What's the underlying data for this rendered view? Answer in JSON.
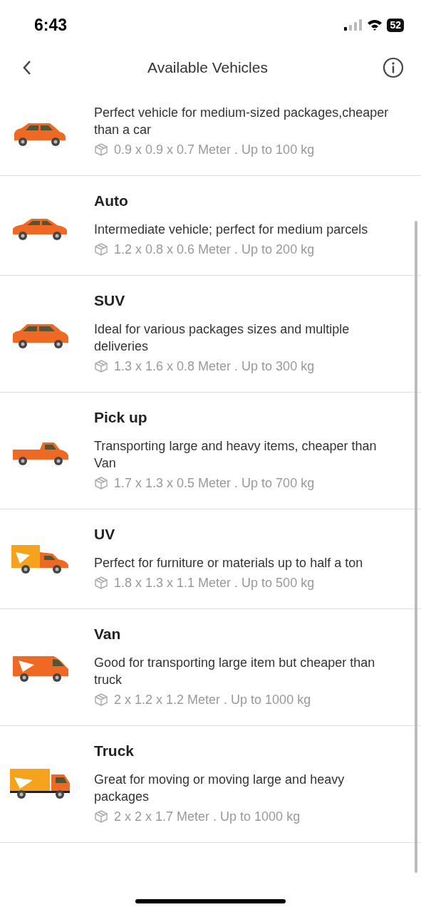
{
  "status_bar": {
    "time": "6:43",
    "battery": "52"
  },
  "header": {
    "title": "Available Vehicles"
  },
  "vehicles": [
    {
      "kind": "hatchback",
      "description": "Perfect vehicle for medium-sized packages,cheaper than a car",
      "spec": "0.9 x 0.9 x 0.7 Meter . Up to 100 kg"
    },
    {
      "kind": "sedan",
      "name": "Auto",
      "description": "Intermediate vehicle; perfect for medium parcels",
      "spec": "1.2 x 0.8 x 0.6 Meter . Up to 200 kg"
    },
    {
      "kind": "suv",
      "name": "SUV",
      "description": "Ideal for various packages sizes and multiple deliveries",
      "spec": "1.3 x 1.6 x 0.8 Meter . Up to 300 kg"
    },
    {
      "kind": "pickup",
      "name": "Pick up",
      "description": "Transporting large and heavy items, cheaper than Van",
      "spec": "1.7 x 1.3 x 0.5 Meter . Up to 700 kg"
    },
    {
      "kind": "uv",
      "name": "UV",
      "description": "Perfect for furniture or materials up to half a ton",
      "spec": "1.8 x 1.3 x 1.1 Meter . Up to 500 kg"
    },
    {
      "kind": "van",
      "name": "Van",
      "description": "Good for transporting large item but cheaper than truck",
      "spec": "2 x 1.2 x 1.2 Meter . Up to 1000 kg"
    },
    {
      "kind": "truck",
      "name": "Truck",
      "description": "Great for moving or moving large and heavy packages",
      "spec": "2 x 2 x 1.7 Meter . Up to 1000 kg"
    }
  ]
}
